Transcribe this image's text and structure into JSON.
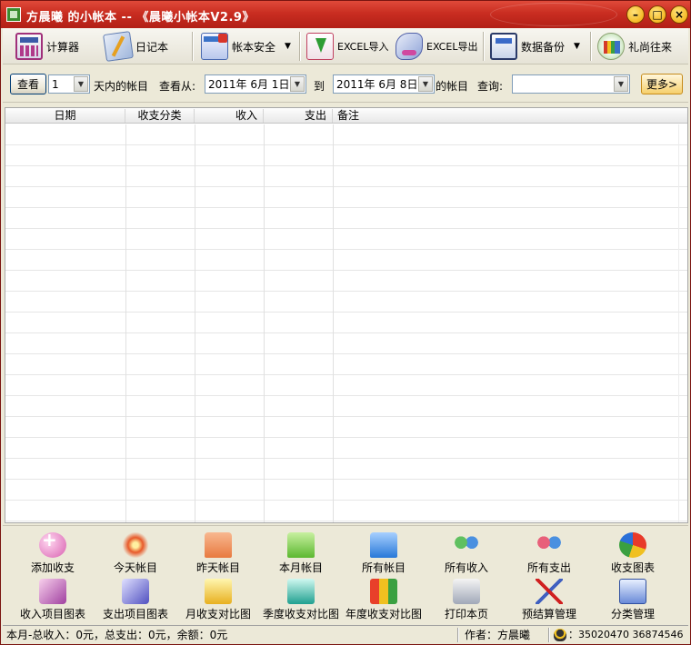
{
  "window": {
    "title": "方晨曦  的小帐本 -- 《晨曦小帐本V2.9》"
  },
  "toolbar": {
    "items": [
      {
        "label": "计算器",
        "icon": "calculator-icon"
      },
      {
        "label": "日记本",
        "icon": "diary-icon"
      },
      {
        "label": "帐本安全",
        "icon": "lock-icon"
      },
      {
        "label": "EXCEL导入",
        "icon": "excel-import-icon"
      },
      {
        "label": "EXCEL导出",
        "icon": "excel-export-icon"
      },
      {
        "label": "数据备份",
        "icon": "backup-icon"
      },
      {
        "label": "礼尚往来",
        "icon": "gift-icon"
      }
    ]
  },
  "filter": {
    "view_button": "查看",
    "days_value": "1",
    "days_suffix": "天内的帐目",
    "from_label": "查看从:",
    "from_date": "2011年 6月 1日",
    "to_label": "到",
    "to_date": "2011年 6月 8日",
    "to_suffix": "的帐目",
    "query_label": "查询:",
    "query_value": "",
    "more_button": "更多>"
  },
  "grid": {
    "columns": [
      "日期",
      "收支分类",
      "收入",
      "支出",
      "备注"
    ],
    "rows": []
  },
  "bottom": {
    "row1": [
      {
        "label": "添加收支",
        "icon": "add-entry-icon"
      },
      {
        "label": "今天帐目",
        "icon": "today-icon"
      },
      {
        "label": "昨天帐目",
        "icon": "yesterday-folder-icon"
      },
      {
        "label": "本月帐目",
        "icon": "month-folder-icon"
      },
      {
        "label": "所有帐目",
        "icon": "all-folder-icon"
      },
      {
        "label": "所有收入",
        "icon": "income-users-icon"
      },
      {
        "label": "所有支出",
        "icon": "expense-users-icon"
      },
      {
        "label": "收支图表",
        "icon": "pie-chart-icon"
      }
    ],
    "row2": [
      {
        "label": "收入项目图表",
        "icon": "income-chart-icon"
      },
      {
        "label": "支出项目图表",
        "icon": "expense-chart-icon"
      },
      {
        "label": "月收支对比图",
        "icon": "monthly-compare-icon"
      },
      {
        "label": "季度收支对比图",
        "icon": "quarterly-compare-icon"
      },
      {
        "label": "年度收支对比图",
        "icon": "yearly-compare-icon"
      },
      {
        "label": "打印本页",
        "icon": "print-icon"
      },
      {
        "label": "预结算管理",
        "icon": "budget-icon"
      },
      {
        "label": "分类管理",
        "icon": "category-icon"
      }
    ]
  },
  "status": {
    "summary": "本月-总收入：0元，总支出：0元，余额：0元",
    "author": "作者：方晨曦",
    "qq": "：35020470  36874546"
  }
}
